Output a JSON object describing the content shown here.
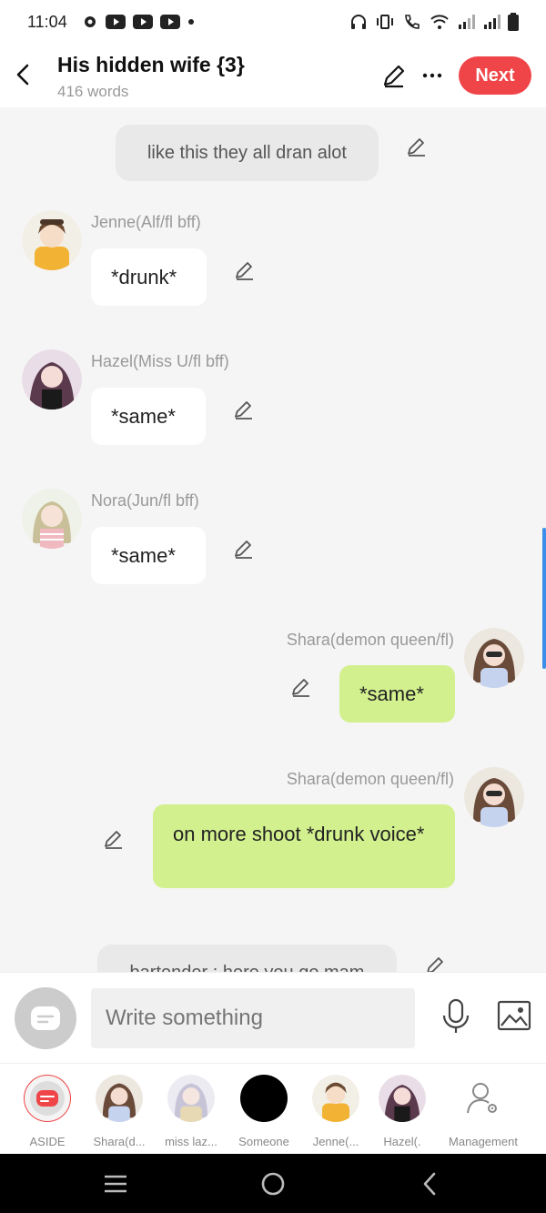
{
  "status_bar": {
    "time": "11:04"
  },
  "header": {
    "title": "His hidden wife {3}",
    "word_count": "416 words",
    "next_label": "Next"
  },
  "messages": [
    {
      "type": "aside",
      "text": "like this they all dran alot"
    },
    {
      "type": "left",
      "name": "Jenne(Alf/fl bff)",
      "text": "*drunk*"
    },
    {
      "type": "left",
      "name": "Hazel(Miss U/fl bff)",
      "text": "*same*"
    },
    {
      "type": "left",
      "name": "Nora(Jun/fl bff)",
      "text": "*same*"
    },
    {
      "type": "right",
      "name": "Shara(demon queen/fl)",
      "text": "*same*"
    },
    {
      "type": "right",
      "name": "Shara(demon queen/fl)",
      "text": "on more shoot *drunk voice*"
    },
    {
      "type": "aside",
      "text": "bartender : here you go mam"
    }
  ],
  "input": {
    "placeholder": "Write something"
  },
  "characters": [
    {
      "label": "ASIDE"
    },
    {
      "label": "Shara(d..."
    },
    {
      "label": "miss laz..."
    },
    {
      "label": "Someone"
    },
    {
      "label": "Jenne(..."
    },
    {
      "label": "Hazel(."
    },
    {
      "label": "Management"
    }
  ],
  "colors": {
    "accent": "#ef4548",
    "user_bubble": "#d2f08e",
    "scroll_indicator": "#3b8fe8"
  }
}
